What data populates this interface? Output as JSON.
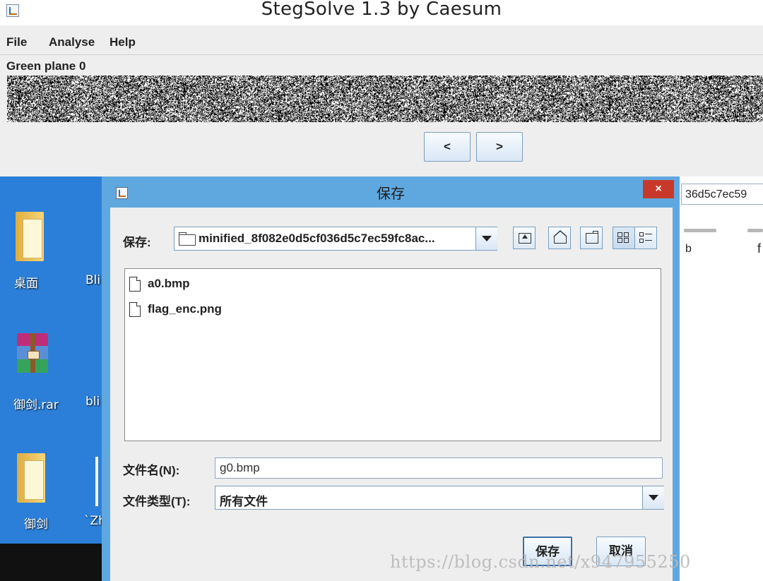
{
  "steg": {
    "title": "StegSolve 1.3 by Caesum",
    "menu": [
      "File",
      "Analyse",
      "Help"
    ],
    "plane_label": "Green plane 0",
    "prev_label": "<",
    "next_label": ">"
  },
  "desktop": {
    "icons": [
      {
        "label": "桌面",
        "icon": "folder-icon"
      },
      {
        "label": "Bli",
        "icon": "partial-icon"
      },
      {
        "label": "御剑.rar",
        "icon": "winrar-icon"
      },
      {
        "label": "bli",
        "icon": "partial-icon"
      },
      {
        "label": "御剑",
        "icon": "folder-icon"
      },
      {
        "label": "`Zh",
        "icon": "partial-icon"
      }
    ]
  },
  "background_window": {
    "address_fragment": "36d5c7ec59",
    "letter1": "b",
    "letter2": "f"
  },
  "dialog": {
    "title": "保存",
    "close_label": "×",
    "save_in_label": "保存:",
    "directory": "minified_8f082e0d5cf036d5c7ec59fc8ac...",
    "files": [
      "a0.bmp",
      "flag_enc.png"
    ],
    "filename_label": "文件名(N):",
    "filename_value": "g0.bmp",
    "filetype_label": "文件类型(T):",
    "filetype_value": "所有文件",
    "save_button": "保存",
    "cancel_button": "取消"
  },
  "watermark": "https://blog.csdn.net/x947955250",
  "colors": {
    "desktop_blue": "#2b7fd8",
    "dialog_border": "#5fa8df",
    "close_red": "#c8392b",
    "panel_gray": "#eeeeee"
  }
}
